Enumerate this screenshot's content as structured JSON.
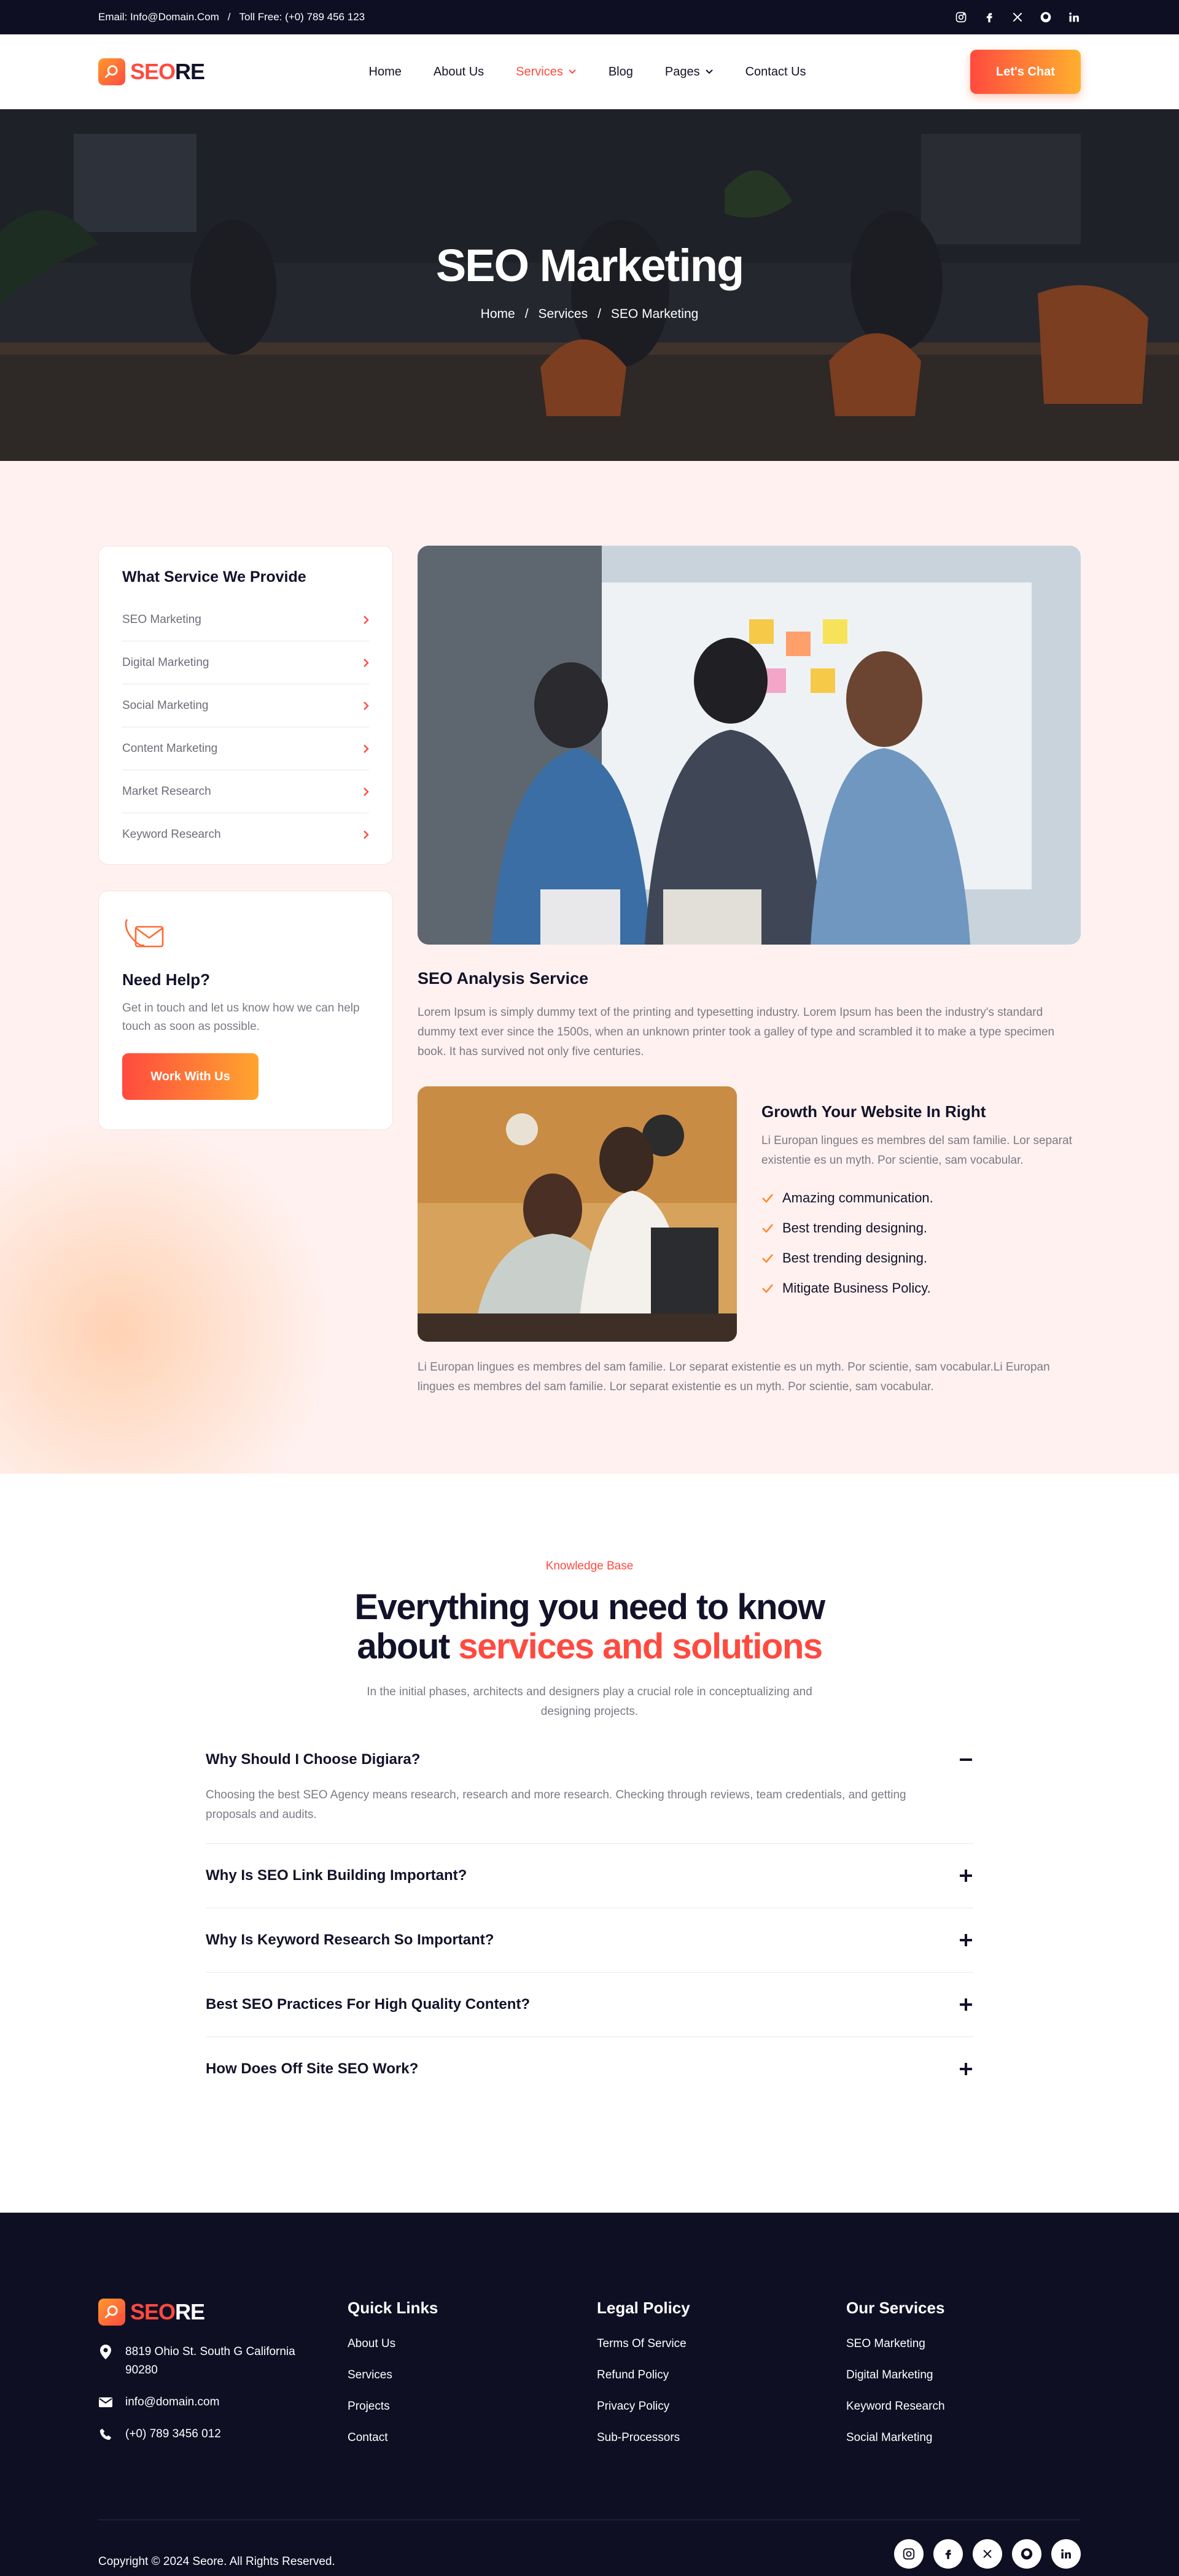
{
  "topbar": {
    "email": "Email: Info@Domain.Com",
    "separator": "/",
    "phone": "Toll Free: (+0) 789 456 123"
  },
  "logo": {
    "part1": "SEO",
    "part2": "RE"
  },
  "nav": {
    "items": [
      "Home",
      "About Us",
      "Services",
      "Blog",
      "Pages",
      "Contact Us"
    ],
    "active": "Services"
  },
  "header": {
    "cta": "Let's Chat"
  },
  "hero": {
    "title": "SEO Marketing",
    "breadcrumbs": [
      "Home",
      "/",
      "Services",
      "/",
      "SEO Marketing"
    ]
  },
  "sidebar": {
    "title": "What Service We Provide",
    "items": [
      "SEO Marketing",
      "Digital Marketing",
      "Social Marketing",
      "Content Marketing",
      "Market Research",
      "Keyword Research"
    ]
  },
  "help": {
    "title": "Need Help?",
    "text": "Get in touch and let us know how we can help touch as soon as possible.",
    "button": "Work With Us"
  },
  "main": {
    "heading": "SEO Analysis Service",
    "paragraph": "Lorem Ipsum is simply dummy text of the printing and typesetting industry. Lorem Ipsum has been the industry's standard dummy text ever since the 1500s, when an unknown printer took a galley of type and scrambled it to make a type specimen book. It has survived not only five centuries.",
    "growth_title": "Growth Your Website In Right",
    "growth_text": "Li Europan lingues es membres del sam familie. Lor separat existentie es un myth. Por scientie, sam vocabular.",
    "checks": [
      "Amazing communication.",
      "Best trending designing.",
      "Best trending designing.",
      "Mitigate Business Policy."
    ],
    "footer_paragraph": "Li Europan lingues es membres del sam familie. Lor separat existentie es un myth. Por scientie, sam vocabular.Li Europan lingues es membres del sam familie. Lor separat existentie es un myth. Por scientie, sam vocabular."
  },
  "faq": {
    "kicker": "Knowledge Base",
    "title_line1": "Everything you need to know",
    "title_line2_plain": "about ",
    "title_line2_accent": "services and solutions",
    "subtitle_line1": "In the initial phases, architects and designers play a crucial role in conceptualizing and",
    "subtitle_line2": "designing projects.",
    "items": [
      {
        "q": "Why Should I Choose Digiara?",
        "a": "Choosing the best SEO Agency means research, research and more research. Checking through reviews, team credentials, and getting proposals and audits."
      },
      {
        "q": "Why Is SEO Link Building Important?"
      },
      {
        "q": "Why Is Keyword Research So Important?"
      },
      {
        "q": "Best SEO Practices For High Quality Content?"
      },
      {
        "q": "How Does Off Site SEO Work?"
      }
    ]
  },
  "footer": {
    "address": "8819 Ohio St. South G California 90280",
    "email": "info@domain.com",
    "phone": "(+0) 789 3456 012",
    "quick_title": "Quick Links",
    "quick_links": [
      "About Us",
      "Services",
      "Projects",
      "Contact"
    ],
    "legal_title": "Legal Policy",
    "legal_links": [
      "Terms Of Service",
      "Refund Policy",
      "Privacy Policy",
      "Sub-Processors"
    ],
    "services_title": "Our Services",
    "services_links": [
      "SEO Marketing",
      "Digital Marketing",
      "Keyword Research",
      "Social Marketing"
    ],
    "copyright": "Copyright © 2024 Seore. All Rights Reserved."
  },
  "icons": {
    "social": [
      "instagram-icon",
      "facebook-icon",
      "x-icon",
      "github-icon",
      "linkedin-icon"
    ]
  },
  "colors": {
    "accent": "#ff4a3f",
    "dark": "#0f0f24",
    "section_bg": "#fff1ef"
  }
}
